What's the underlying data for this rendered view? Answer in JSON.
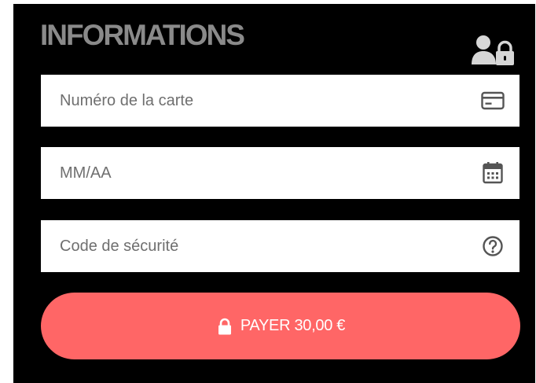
{
  "heading": "INFORMATIONS",
  "fields": [
    {
      "placeholder": "Numéro de la carte",
      "icon": "credit-card-icon",
      "value": ""
    },
    {
      "placeholder": "MM/AA",
      "icon": "calendar-icon",
      "value": ""
    },
    {
      "placeholder": "Code de sécurité",
      "icon": "help-circle-icon",
      "value": ""
    }
  ],
  "pay_button": {
    "label": "PAYER 30,00 €",
    "icon": "lock-icon"
  },
  "header_icon": "user-lock-icon",
  "colors": {
    "panel_background": "#000000",
    "heading": "#8a8a8a",
    "field_background": "#ffffff",
    "placeholder": "#6f6f6f",
    "field_icon": "#555555",
    "button": "#ff6666",
    "button_text": "#ffffff"
  }
}
